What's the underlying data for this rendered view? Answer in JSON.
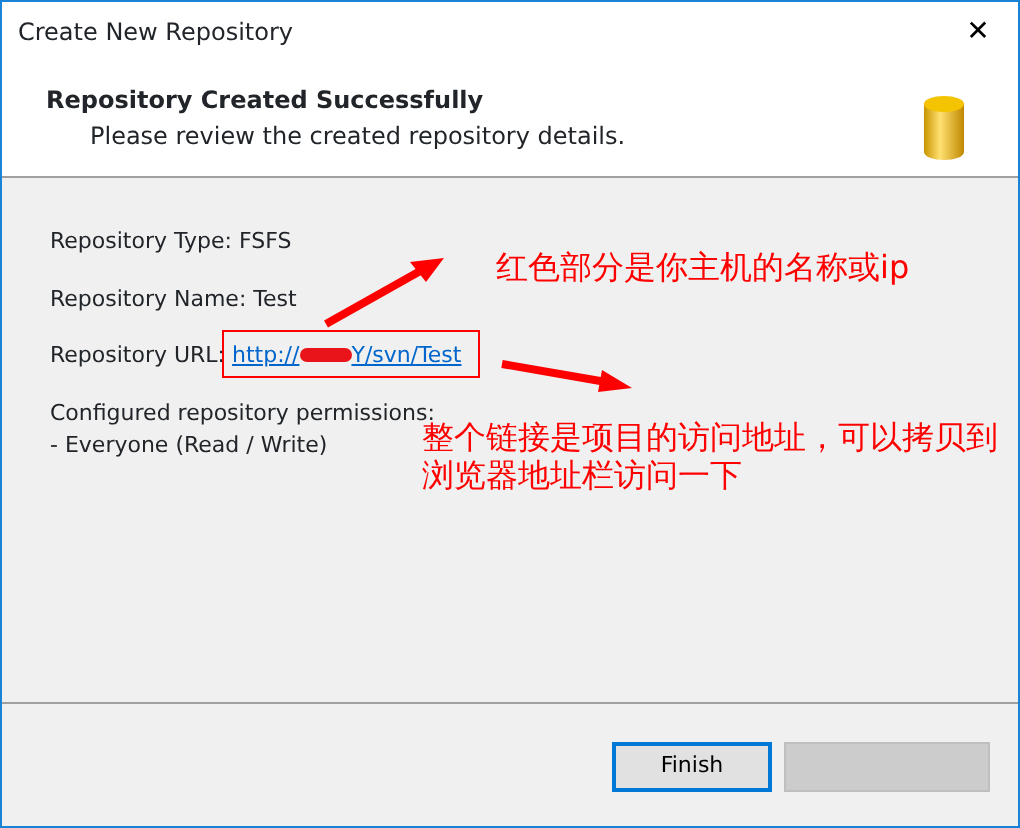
{
  "window": {
    "title": "Create New Repository",
    "close": "✕"
  },
  "header": {
    "title": "Repository Created Successfully",
    "subtitle": "Please review the created repository details."
  },
  "details": [
    {
      "kind": "text",
      "label": "Repository Type: FSFS"
    },
    {
      "kind": "text",
      "label": "Repository Name: Test"
    },
    {
      "kind": "link",
      "label": "Repository URL: ",
      "url_start": "http://",
      "url_end": "Y/svn/Test"
    },
    {
      "kind": "text",
      "label": "Configured repository permissions:"
    },
    {
      "kind": "text",
      "label": "- Everyone (Read / Write)"
    }
  ],
  "annotations": [
    "红色部分是你主机的名称或ip",
    "整个链接是项目的访问地址，可以拷贝到浏览器地址栏访问一下"
  ],
  "buttons": [
    {
      "label": "Finish",
      "disabled": false,
      "focused": true
    },
    {
      "disabled": true,
      "focused": false
    }
  ]
}
